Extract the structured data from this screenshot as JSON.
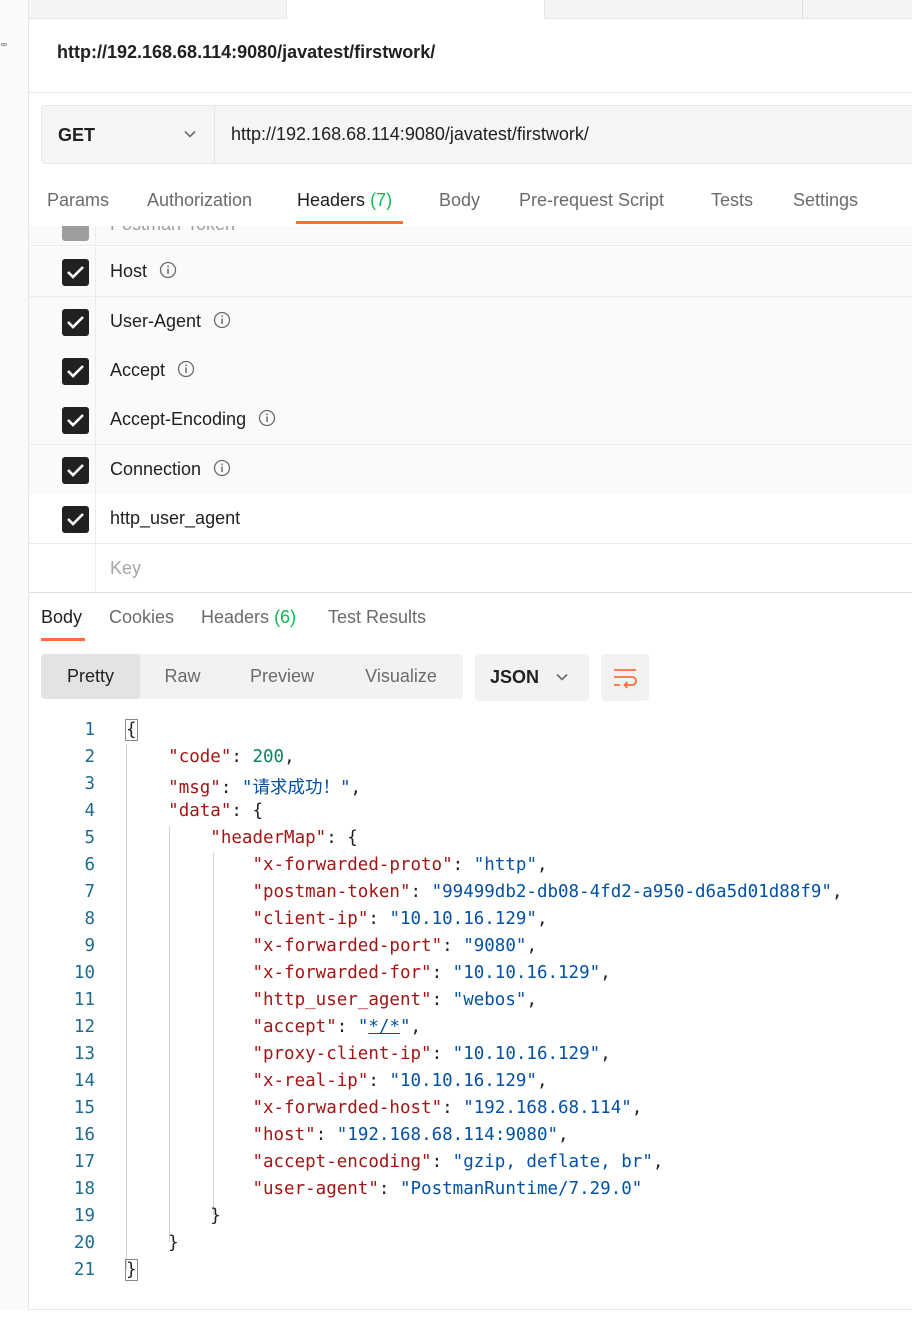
{
  "request": {
    "title": "http://192.168.68.114:9080/javatest/firstwork/",
    "method": "GET",
    "url": "http://192.168.68.114:9080/javatest/firstwork/"
  },
  "request_tabs": [
    {
      "label": "Params"
    },
    {
      "label": "Authorization"
    },
    {
      "label": "Headers",
      "count": "(7)"
    },
    {
      "label": "Body"
    },
    {
      "label": "Pre-request Script"
    },
    {
      "label": "Tests"
    },
    {
      "label": "Settings"
    }
  ],
  "headers": [
    {
      "key": "Postman-Token"
    },
    {
      "key": "Host"
    },
    {
      "key": "User-Agent"
    },
    {
      "key": "Accept"
    },
    {
      "key": "Accept-Encoding"
    },
    {
      "key": "Connection"
    },
    {
      "key": "http_user_agent"
    }
  ],
  "new_header_placeholder": "Key",
  "response_tabs": [
    {
      "label": "Body"
    },
    {
      "label": "Cookies"
    },
    {
      "label": "Headers",
      "count": "(6)"
    },
    {
      "label": "Test Results"
    }
  ],
  "view_modes": [
    "Pretty",
    "Raw",
    "Preview",
    "Visualize"
  ],
  "format": "JSON",
  "icons": {
    "method_dropdown": "chevron-down-icon",
    "info": "info-icon",
    "checkbox": "checkbox-checked-icon",
    "wrap": "wrap-lines-icon",
    "accent": "#ff6c37",
    "count_color": "#0cbb52"
  },
  "body": {
    "line_numbers": [
      "1",
      "2",
      "3",
      "4",
      "5",
      "6",
      "7",
      "8",
      "9",
      "10",
      "11",
      "12",
      "13",
      "14",
      "15",
      "16",
      "17",
      "18",
      "19",
      "20",
      "21"
    ],
    "code": 200,
    "msg": "请求成功！",
    "header_map": [
      {
        "key": "x-forwarded-proto",
        "value": "http"
      },
      {
        "key": "postman-token",
        "value": "99499db2-db08-4fd2-a950-d6a5d01d88f9"
      },
      {
        "key": "client-ip",
        "value": "10.10.16.129"
      },
      {
        "key": "x-forwarded-port",
        "value": "9080"
      },
      {
        "key": "x-forwarded-for",
        "value": "10.10.16.129"
      },
      {
        "key": "http_user_agent",
        "value": "webos"
      },
      {
        "key": "accept",
        "value": "*/*"
      },
      {
        "key": "proxy-client-ip",
        "value": "10.10.16.129"
      },
      {
        "key": "x-real-ip",
        "value": "10.10.16.129"
      },
      {
        "key": "x-forwarded-host",
        "value": "192.168.68.114"
      },
      {
        "key": "host",
        "value": "192.168.68.114:9080"
      },
      {
        "key": "accept-encoding",
        "value": "gzip, deflate, br"
      },
      {
        "key": "user-agent",
        "value": "PostmanRuntime/7.29.0"
      }
    ]
  }
}
